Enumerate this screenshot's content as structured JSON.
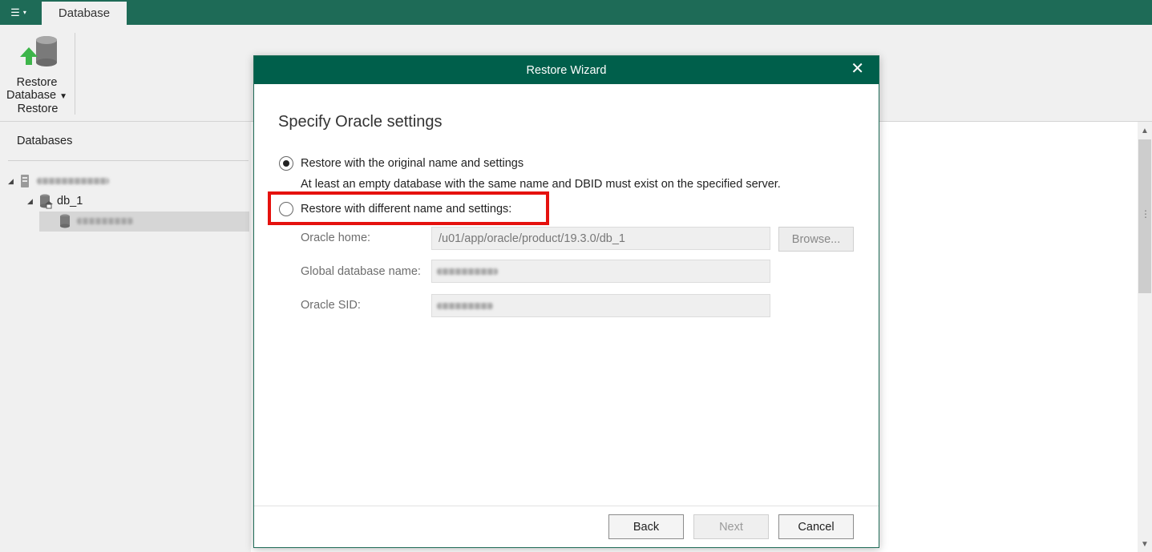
{
  "topbar": {
    "menu_icon": "hamburger-icon",
    "tab_label": "Database"
  },
  "ribbon": {
    "restore_button_line1": "Restore",
    "restore_button_line2": "Database",
    "group_label": "Restore",
    "icon": "restore-database-icon"
  },
  "left_panel": {
    "title": "Databases",
    "tree": {
      "server_label": "(redacted)",
      "db_label": "db_1",
      "instance_label": "(redacted)"
    }
  },
  "dialog": {
    "title": "Restore Wizard",
    "heading": "Specify Oracle settings",
    "option_original": {
      "label": "Restore with the original name and settings",
      "description": "At least an empty database with the same name and DBID must exist on the specified server.",
      "checked": true
    },
    "option_different": {
      "label": "Restore with different name and settings:",
      "checked": false
    },
    "fields": {
      "oracle_home_label": "Oracle home:",
      "oracle_home_value": "/u01/app/oracle/product/19.3.0/db_1",
      "global_db_name_label": "Global database name:",
      "oracle_sid_label": "Oracle SID:",
      "browse_label": "Browse..."
    },
    "buttons": {
      "back": "Back",
      "next": "Next",
      "cancel": "Cancel"
    }
  },
  "colors": {
    "accent": "#1e6b57",
    "dialog_title": "#005f4b",
    "highlight": "#e5110e"
  }
}
